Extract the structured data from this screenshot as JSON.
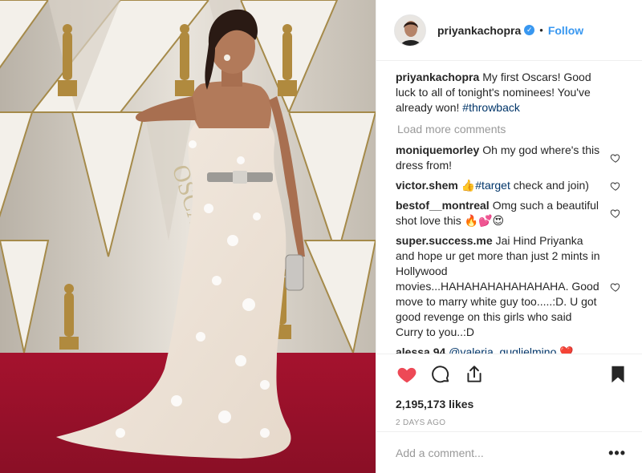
{
  "post": {
    "username": "priyankachopra",
    "verified_icon": "verified-badge-icon",
    "separator": "•",
    "follow_label": "Follow"
  },
  "caption": {
    "username": "priyankachopra",
    "text": "My first Oscars! Good luck to all of tonight's nominees! You've already won!",
    "hashtag": "#throwback"
  },
  "load_more_label": "Load more comments",
  "comments": [
    {
      "user": "moniquemorley",
      "text": "Oh my god where's this dress from!"
    },
    {
      "user": "victor.shem",
      "emoji": "👍",
      "tag": "#target",
      "text": "check and join)"
    },
    {
      "user": "bestof__montreal",
      "text": "Omg such a beautiful shot love this",
      "emoji": "🔥💕😍"
    },
    {
      "user": "super.success.me",
      "text": "Jai Hind Priyanka and hope ur get more than just 2 mints in Hollywood movies...HAHAHAHAHAHAHAHA. Good move to marry white guy too.....:D. U got good revenge on this girls who said Curry to you..:D"
    },
    {
      "user": "alessa 94",
      "tag": "@valeria_guglielmino",
      "emoji": "❤️"
    }
  ],
  "actions": {
    "like_icon": "heart-filled-icon",
    "comment_icon": "comment-bubble-icon",
    "share_icon": "share-icon",
    "save_icon": "bookmark-icon",
    "like_color": "#ed4956"
  },
  "likes_text": "2,195,173 likes",
  "time_ago": "2 DAYS AGO",
  "add_comment": {
    "placeholder": "Add a comment...",
    "more": "•••"
  }
}
